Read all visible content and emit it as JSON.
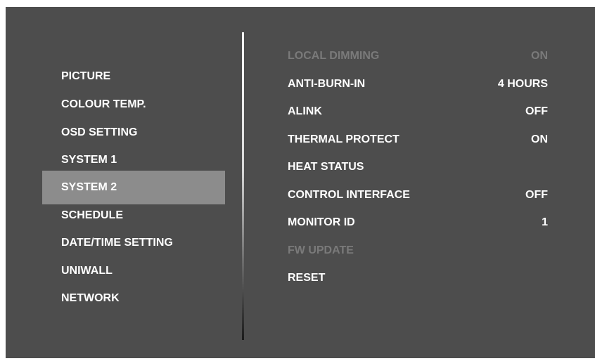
{
  "left_menu": {
    "items": [
      {
        "label": "PICTURE"
      },
      {
        "label": "COLOUR TEMP."
      },
      {
        "label": "OSD SETTING"
      },
      {
        "label": "SYSTEM 1"
      },
      {
        "label": "SYSTEM 2",
        "selected": true
      },
      {
        "label": "SCHEDULE"
      },
      {
        "label": "DATE/TIME SETTING"
      },
      {
        "label": "UNIWALL"
      },
      {
        "label": "NETWORK"
      }
    ]
  },
  "right_menu": {
    "items": [
      {
        "label": "LOCAL DIMMING",
        "value": "ON",
        "disabled": true
      },
      {
        "label": "ANTI-BURN-IN",
        "value": "4 HOURS"
      },
      {
        "label": "ALINK",
        "value": "OFF"
      },
      {
        "label": "THERMAL PROTECT",
        "value": "ON"
      },
      {
        "label": "HEAT STATUS",
        "value": ""
      },
      {
        "label": "CONTROL INTERFACE",
        "value": "OFF"
      },
      {
        "label": "MONITOR ID",
        "value": "1"
      },
      {
        "label": "FW UPDATE",
        "value": "",
        "disabled": true
      },
      {
        "label": "RESET",
        "value": ""
      }
    ]
  },
  "colors": {
    "background": "#4d4d4d",
    "selected_highlight": "#8c8c8c",
    "text": "#ffffff",
    "disabled_text": "#7a7a7a"
  }
}
